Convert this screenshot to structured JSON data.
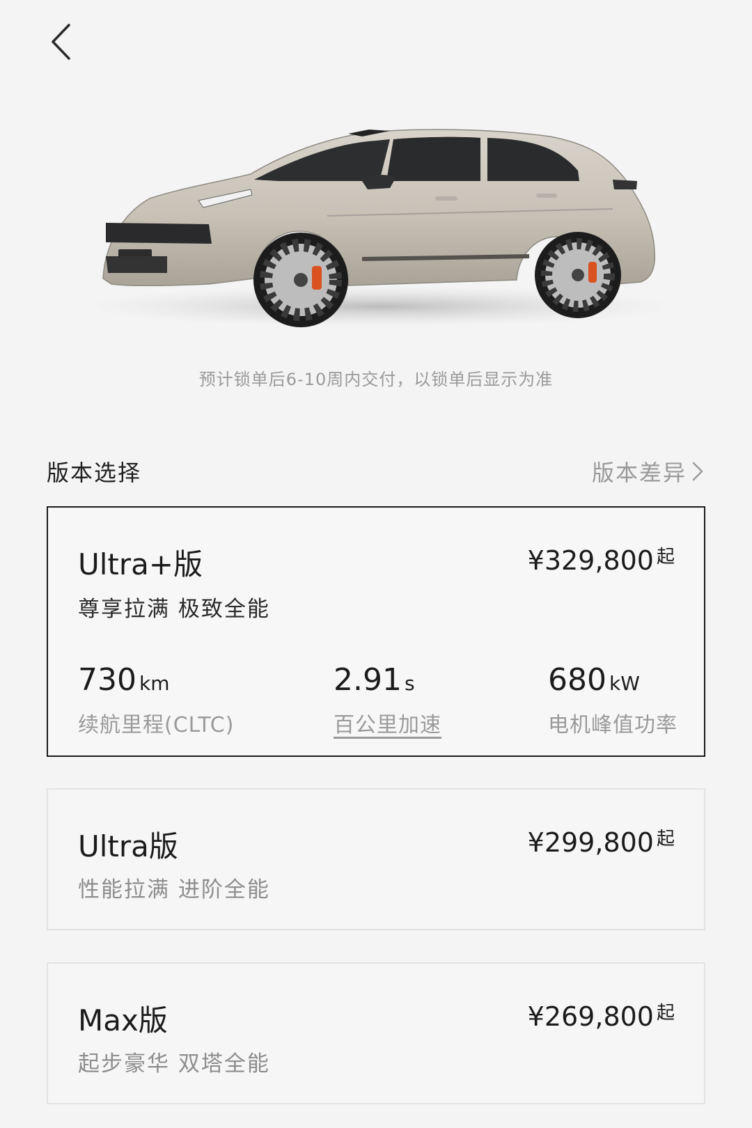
{
  "nav": {
    "back_icon": "chevron-left-icon"
  },
  "hero": {
    "image": "car-side-profile"
  },
  "delivery_note": "预计锁单后6-10周内交付，以锁单后显示为准",
  "section": {
    "title": "版本选择",
    "diff_link": "版本差异"
  },
  "variants": [
    {
      "name": "Ultra+版",
      "price": "¥329,800",
      "price_suffix": "起",
      "slogan": "尊享拉满 极致全能",
      "selected": true,
      "specs": [
        {
          "value": "730",
          "unit": "km",
          "label": "续航里程(CLTC)"
        },
        {
          "value": "2.91",
          "unit": "s",
          "label": "百公里加速"
        },
        {
          "value": "680",
          "unit": "kW",
          "label": "电机峰值功率"
        }
      ]
    },
    {
      "name": "Ultra版",
      "price": "¥299,800",
      "price_suffix": "起",
      "slogan": "性能拉满 进阶全能",
      "selected": false
    },
    {
      "name": "Max版",
      "price": "¥269,800",
      "price_suffix": "起",
      "slogan": "起步豪华 双塔全能",
      "selected": false
    }
  ],
  "colors": {
    "selected_border": "#1b1b1b",
    "card_border": "#e2e2e2",
    "muted_text": "#9a9a9a",
    "caliper": "#d9521f"
  }
}
